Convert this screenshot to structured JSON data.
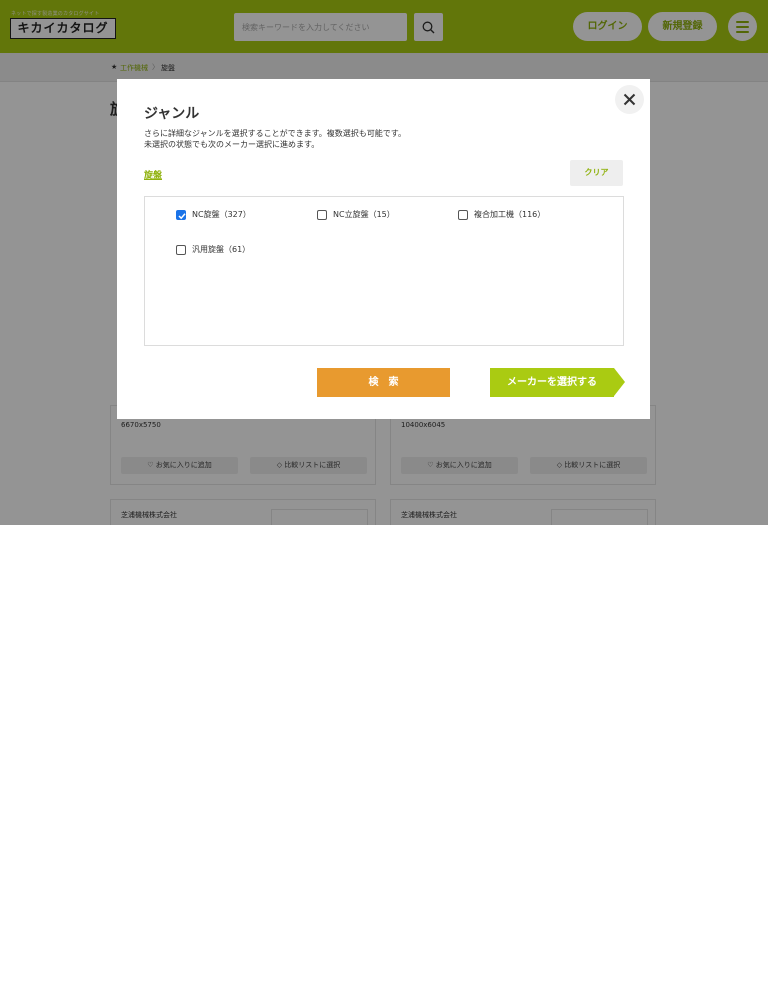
{
  "header": {
    "logo_sub": "ネットで探す製造業のカタログサイト",
    "logo": "キカイカタログ",
    "search_placeholder": "検索キーワードを入力してください",
    "login_label": "ログイン",
    "signup_label": "新規登録"
  },
  "breadcrumb": {
    "items": [
      "工作機械",
      "旋盤"
    ],
    "separator": "〉"
  },
  "page": {
    "title_partial": "旋"
  },
  "cards": [
    {
      "size": "6670x5750",
      "favorite_label": "お気に入りに追加",
      "compare_label": "比較リストに選択"
    },
    {
      "size": "10400x6045",
      "favorite_label": "お気に入りに追加",
      "compare_label": "比較リストに選択"
    },
    {
      "maker": "芝浦機械株式会社"
    },
    {
      "maker": "芝浦機械株式会社"
    }
  ],
  "modal": {
    "title": "ジャンル",
    "description_lines": [
      "さらに詳細なジャンルを選択することができます。複数選択も可能です。",
      "未選択の状態でも次のメーカー選択に進めます。"
    ],
    "current_genre": "旋盤",
    "clear_label": "クリア",
    "options": [
      {
        "label": "NC旋盤（327）",
        "checked": true
      },
      {
        "label": "NC立旋盤（15）",
        "checked": false
      },
      {
        "label": "複合加工機（116）",
        "checked": false
      },
      {
        "label": "汎用旋盤（61）",
        "checked": false
      }
    ],
    "search_label": "検　索",
    "maker_select_label": "メーカーを選択する"
  },
  "colors": {
    "brand_green": "#aacb12",
    "accent_orange": "#e89a2f",
    "checkbox_blue": "#1a73e8"
  }
}
